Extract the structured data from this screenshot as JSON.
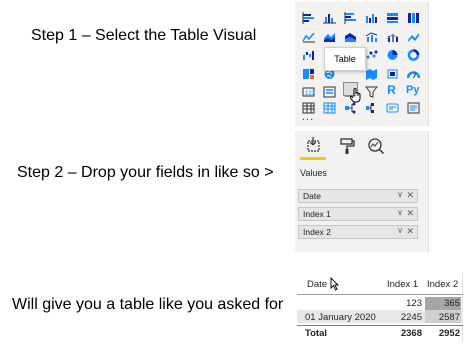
{
  "steps": {
    "step1": "Step 1 – Select the Table Visual",
    "step2": "Step 2 – Drop your fields in like so >",
    "step3": "Will give you a table like you asked for"
  },
  "gallery": {
    "tooltip": "Table",
    "text_icons": {
      "r": "R",
      "py": "Py"
    },
    "more": "...",
    "accent": "#118dff"
  },
  "fields_pane": {
    "section_label": "Values",
    "wells": [
      {
        "label": "Date"
      },
      {
        "label": "Index 1"
      },
      {
        "label": "Index 2"
      }
    ],
    "chevron": "∨",
    "remove": "✕",
    "underline_color": "#f2c811"
  },
  "result_table": {
    "headers": [
      "Date",
      "Index 1",
      "Index 2"
    ],
    "rows": [
      [
        "",
        "123",
        "365"
      ],
      [
        "01 January 2020",
        "2245",
        "2587"
      ]
    ],
    "total": [
      "Total",
      "2368",
      "2952"
    ]
  }
}
